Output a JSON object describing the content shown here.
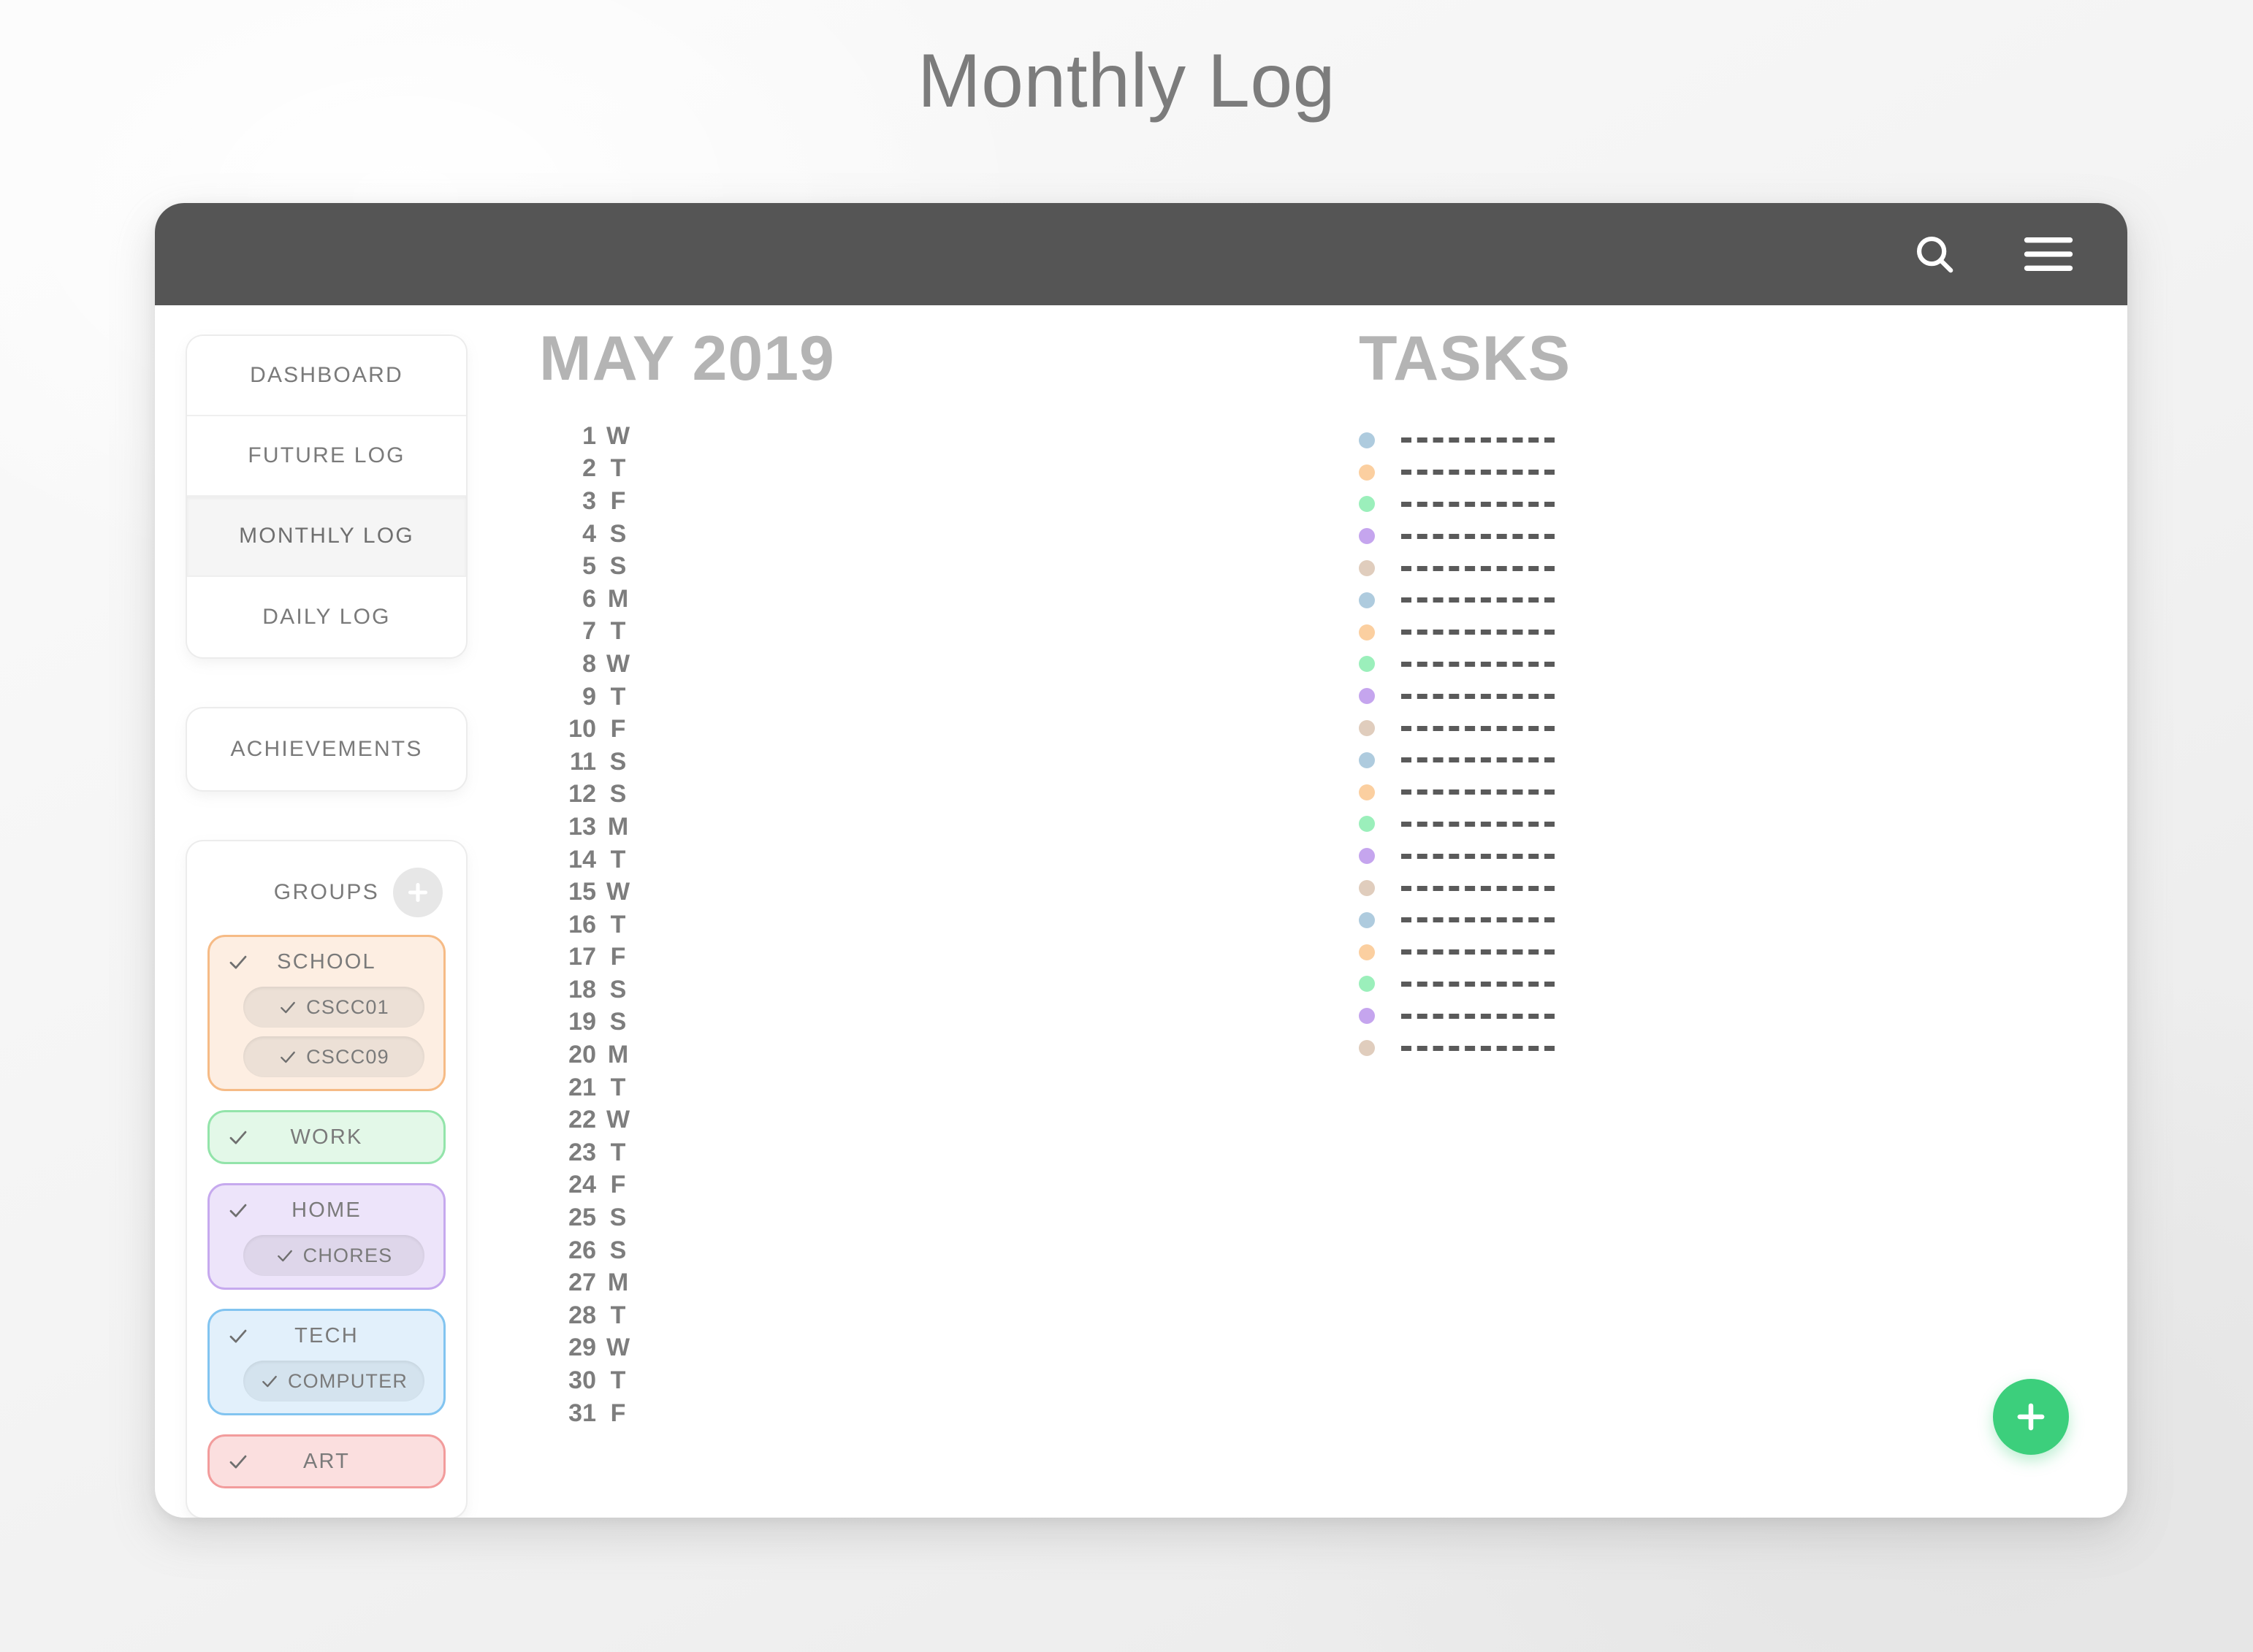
{
  "page": {
    "title": "Monthly Log"
  },
  "titlebar": {
    "search_icon": "search-icon",
    "menu_icon": "hamburger-menu-icon"
  },
  "sidebar": {
    "nav_items": [
      {
        "label": "DASHBOARD",
        "active": false
      },
      {
        "label": "FUTURE LOG",
        "active": false
      },
      {
        "label": "MONTHLY LOG",
        "active": true
      },
      {
        "label": "DAILY LOG",
        "active": false
      }
    ],
    "achievements": {
      "label": "ACHIEVEMENTS"
    },
    "groups": {
      "title": "GROUPS",
      "add_button_icon": "plus-icon",
      "items": [
        {
          "label": "SCHOOL",
          "color": "g-orange",
          "accent": "#f6bb86",
          "checked": true,
          "children": [
            {
              "label": "CSCC01",
              "checked": true
            },
            {
              "label": "CSCC09",
              "checked": true
            }
          ]
        },
        {
          "label": "WORK",
          "color": "g-green",
          "accent": "#93e4aa",
          "checked": true,
          "children": []
        },
        {
          "label": "HOME",
          "color": "g-purple",
          "accent": "#c6a9ee",
          "checked": true,
          "children": [
            {
              "label": "CHORES",
              "checked": true
            }
          ]
        },
        {
          "label": "TECH",
          "color": "g-blue",
          "accent": "#82c4f0",
          "checked": true,
          "children": [
            {
              "label": "COMPUTER",
              "checked": true
            }
          ]
        },
        {
          "label": "ART",
          "color": "g-red",
          "accent": "#f29c9c",
          "checked": true,
          "children": []
        }
      ]
    }
  },
  "month": {
    "title": "MAY 2019",
    "days": [
      {
        "num": "1",
        "dow": "W"
      },
      {
        "num": "2",
        "dow": "T"
      },
      {
        "num": "3",
        "dow": "F"
      },
      {
        "num": "4",
        "dow": "S"
      },
      {
        "num": "5",
        "dow": "S"
      },
      {
        "num": "6",
        "dow": "M"
      },
      {
        "num": "7",
        "dow": "T"
      },
      {
        "num": "8",
        "dow": "W"
      },
      {
        "num": "9",
        "dow": "T"
      },
      {
        "num": "10",
        "dow": "F"
      },
      {
        "num": "11",
        "dow": "S"
      },
      {
        "num": "12",
        "dow": "S"
      },
      {
        "num": "13",
        "dow": "M"
      },
      {
        "num": "14",
        "dow": "T"
      },
      {
        "num": "15",
        "dow": "W"
      },
      {
        "num": "16",
        "dow": "T"
      },
      {
        "num": "17",
        "dow": "F"
      },
      {
        "num": "18",
        "dow": "S"
      },
      {
        "num": "19",
        "dow": "S"
      },
      {
        "num": "20",
        "dow": "M"
      },
      {
        "num": "21",
        "dow": "T"
      },
      {
        "num": "22",
        "dow": "W"
      },
      {
        "num": "23",
        "dow": "T"
      },
      {
        "num": "24",
        "dow": "F"
      },
      {
        "num": "25",
        "dow": "S"
      },
      {
        "num": "26",
        "dow": "S"
      },
      {
        "num": "27",
        "dow": "M"
      },
      {
        "num": "28",
        "dow": "T"
      },
      {
        "num": "29",
        "dow": "W"
      },
      {
        "num": "30",
        "dow": "T"
      },
      {
        "num": "31",
        "dow": "F"
      }
    ]
  },
  "tasks": {
    "title": "TASKS",
    "placeholder_text": "----------------",
    "dot_palette": [
      "#aecbde",
      "#fbcfa0",
      "#9befbb",
      "#c5a5ee",
      "#e0cdbd"
    ],
    "rows": [
      {
        "dot": "#aecbde"
      },
      {
        "dot": "#fbcfa0"
      },
      {
        "dot": "#9befbb"
      },
      {
        "dot": "#c5a5ee"
      },
      {
        "dot": "#e0cdbd"
      },
      {
        "dot": "#aecbde"
      },
      {
        "dot": "#fbcfa0"
      },
      {
        "dot": "#9befbb"
      },
      {
        "dot": "#c5a5ee"
      },
      {
        "dot": "#e0cdbd"
      },
      {
        "dot": "#aecbde"
      },
      {
        "dot": "#fbcfa0"
      },
      {
        "dot": "#9befbb"
      },
      {
        "dot": "#c5a5ee"
      },
      {
        "dot": "#e0cdbd"
      },
      {
        "dot": "#aecbde"
      },
      {
        "dot": "#fbcfa0"
      },
      {
        "dot": "#9befbb"
      },
      {
        "dot": "#c5a5ee"
      },
      {
        "dot": "#e0cdbd"
      }
    ]
  },
  "fab": {
    "icon": "plus-icon",
    "color": "#3ccf7c"
  }
}
